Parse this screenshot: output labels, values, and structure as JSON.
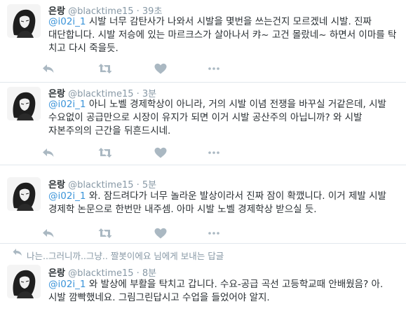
{
  "tweets": [
    {
      "name": "은랑",
      "handle": "@blacktime15",
      "separator": "·",
      "time": "39초",
      "mention": "@i02i_1",
      "text": " 시발 너무 감탄사가 나와서 시발을 몇번을 쓰는건지 모르겠네 시발. 진짜 대단합니다. 시발 저승에 있는 마르크스가 살아나서 캬~ 고건 몰랐네~ 하면서 이마를 탁 치고 다시 죽을듯."
    },
    {
      "name": "은랑",
      "handle": "@blacktime15",
      "separator": "·",
      "time": "3분",
      "mention": "@i02i_1",
      "text": " 아니 노벨 경제학상이 아니라, 거의 시발 이념 전쟁을 바꾸실 거같은데, 시발 수요없이 공급만으로 시장이 유지가 되면 이거 시발 공산주의 아닙니까? 와 시발 자본주의의 근간을 뒤흔드시네."
    },
    {
      "name": "은랑",
      "handle": "@blacktime15",
      "separator": "·",
      "time": "5분",
      "mention": "@i02i_1",
      "text": " 와. 잠드려다가 너무 놀라운 발상이라서 진짜 잠이 확깼니다. 이거 제발 시발 경제학 논문으로 한번만 내주셈. 아마 시발 노벨 경제학상 받으실 듯."
    },
    {
      "context": "나는..그러니까..그냥.. 짤봇이에요 님에게 보내는 답글",
      "name": "은랑",
      "handle": "@blacktime15",
      "separator": "·",
      "time": "8분",
      "mention": "@i02i_1",
      "text": " 와 발상에 부활을 탁치고 갑니다. 수요-공급 곡선 고등학교때 안배웠음? 아. 시발 깜빡했네요. 그림그린답시고 수업을 들었어야 알지."
    }
  ],
  "icons": [
    "reply-icon",
    "retweet-icon",
    "like-icon",
    "more-icon",
    "reply-context-icon"
  ],
  "colors": {
    "link": "#3b94d9",
    "muted": "#8899a6",
    "icon": "#aab8c2",
    "text": "#292f33",
    "border": "#e1e8ed"
  }
}
